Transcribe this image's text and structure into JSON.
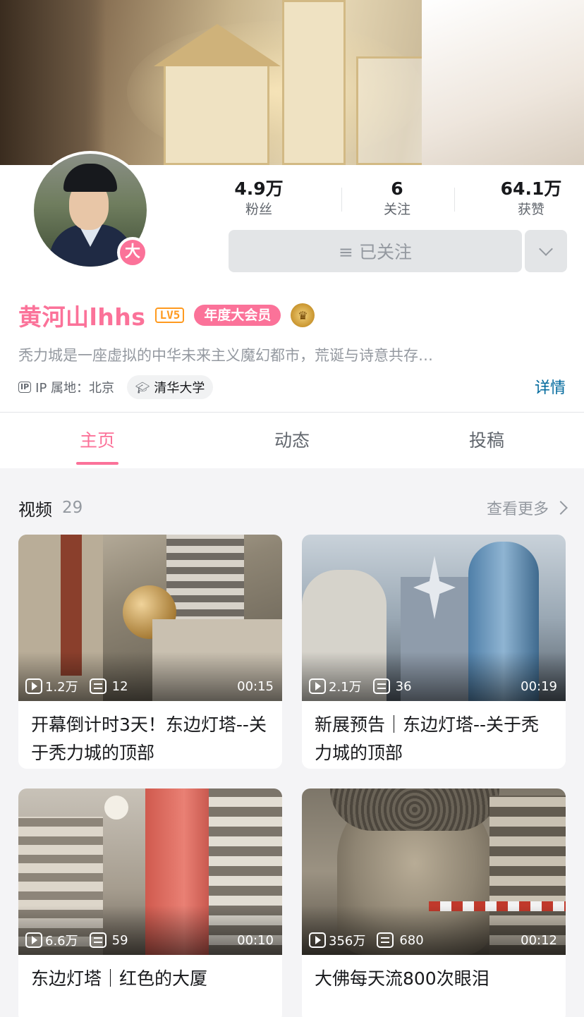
{
  "profile": {
    "username": "黄河山lhhs",
    "level": "LV5",
    "vip_tag": "年度大会员",
    "avatar_badge": "大",
    "bio": "秃力城是一座虚拟的中华未来主义魔幻都市，荒诞与诗意共存…",
    "ip_label": "IP 属地：北京",
    "school": "清华大学",
    "detail_link": "详情",
    "follow_button": "≡ 已关注"
  },
  "stats": [
    {
      "value": "4.9万",
      "label": "粉丝"
    },
    {
      "value": "6",
      "label": "关注"
    },
    {
      "value": "64.1万",
      "label": "获赞"
    }
  ],
  "tabs": [
    {
      "label": "主页",
      "active": true
    },
    {
      "label": "动态",
      "active": false
    },
    {
      "label": "投稿",
      "active": false
    }
  ],
  "videos_section": {
    "title": "视频",
    "count": "29",
    "see_more": "查看更多"
  },
  "videos": [
    {
      "plays": "1.2万",
      "danmaku": "12",
      "duration": "00:15",
      "title": "开幕倒计时3天！东边灯塔--关于秃力城的顶部"
    },
    {
      "plays": "2.1万",
      "danmaku": "36",
      "duration": "00:19",
      "title": "新展预告｜东边灯塔--关于秃力城的顶部"
    },
    {
      "plays": "6.6万",
      "danmaku": "59",
      "duration": "00:10",
      "title": "东边灯塔｜红色的大厦"
    },
    {
      "plays": "356万",
      "danmaku": "680",
      "duration": "00:12",
      "title": "大佛每天流800次眼泪"
    }
  ],
  "colors": {
    "brand_pink": "#fb7299",
    "link_blue": "#00699d",
    "level_orange": "#ff9a1f"
  }
}
